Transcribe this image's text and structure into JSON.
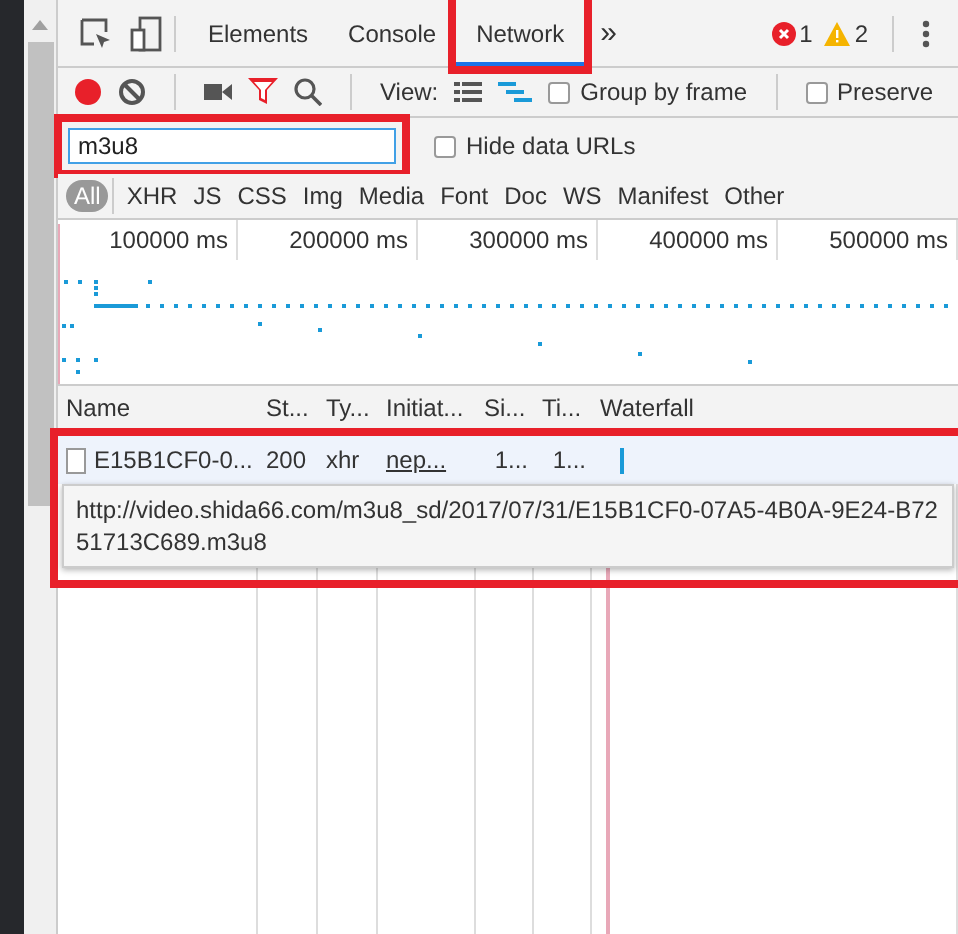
{
  "tabs": [
    {
      "label": "Elements",
      "selected": false,
      "highlighted": false
    },
    {
      "label": "Console",
      "selected": false,
      "highlighted": false
    },
    {
      "label": "Network",
      "selected": true,
      "highlighted": true
    }
  ],
  "more_tabs": "»",
  "errors": "1",
  "warnings": "2",
  "toolbar": {
    "recording": true,
    "view_label": "View:",
    "options": [
      {
        "label": "Group by frame",
        "checked": false
      },
      {
        "label": "Preserve",
        "checked": false
      }
    ]
  },
  "filter": {
    "value": "m3u8",
    "highlighted": true,
    "hide_data_urls": {
      "label": "Hide data URLs",
      "checked": false
    }
  },
  "types": [
    {
      "label": "All",
      "selected": true
    },
    {
      "label": "XHR",
      "selected": false
    },
    {
      "label": "JS",
      "selected": false
    },
    {
      "label": "CSS",
      "selected": false
    },
    {
      "label": "Img",
      "selected": false
    },
    {
      "label": "Media",
      "selected": false
    },
    {
      "label": "Font",
      "selected": false
    },
    {
      "label": "Doc",
      "selected": false
    },
    {
      "label": "WS",
      "selected": false
    },
    {
      "label": "Manifest",
      "selected": false
    },
    {
      "label": "Other",
      "selected": false
    }
  ],
  "overview": {
    "ticks": [
      "100000 ms",
      "200000 ms",
      "300000 ms",
      "400000 ms",
      "500000 ms"
    ]
  },
  "table": {
    "columns": [
      "Name",
      "St...",
      "Ty...",
      "Initiat...",
      "Si...",
      "Ti...",
      "Waterfall"
    ],
    "rows": [
      {
        "highlighted": true,
        "cells": [
          "E15B1CF0-0...",
          "200",
          "xhr",
          "nep...",
          "1...",
          "1..."
        ],
        "tooltip": "http://video.shida66.com/m3u8_sd/2017/07/31/E15B1CF0-07A5-4B0A-9E24-B7251713C689.m3u8"
      }
    ]
  }
}
